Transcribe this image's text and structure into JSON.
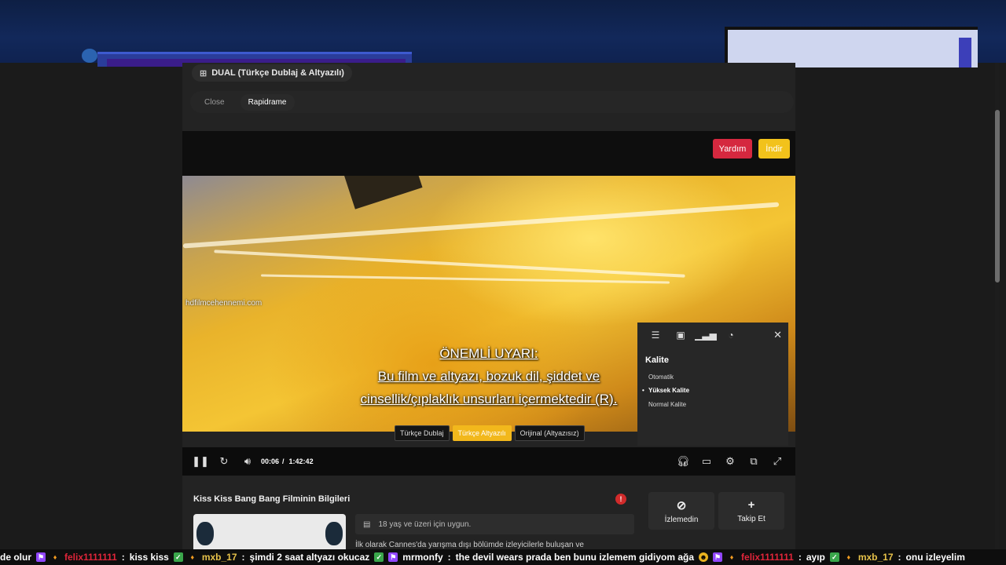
{
  "player": {
    "language_pill": "DUAL (Türkçe Dublaj & Altyazılı)",
    "tabs": [
      {
        "label": "Close"
      },
      {
        "label": "Rapidrame",
        "active": true
      }
    ],
    "help_label": "Yardım",
    "download_label": "İndir",
    "watermark": "hdfilmcehennemi.com",
    "subtitle_lines": [
      "ÖNEMLİ UYARI:",
      "Bu film ve altyazı, bozuk dil, şiddet ve",
      "cinsellik/çıplaklık unsurları içermektedir (R)."
    ],
    "audio_options": [
      {
        "label": "Türkçe Dublaj",
        "selected": false
      },
      {
        "label": "Türkçe Altyazılı",
        "selected": true
      },
      {
        "label": "Orijinal (Altyazısız)",
        "selected": false
      }
    ],
    "time_current": "00:06",
    "time_separator": "/",
    "time_total": "1:42:42",
    "settings": {
      "heading": "Kalite",
      "options": [
        {
          "label": "Otomatik",
          "selected": false
        },
        {
          "label": "Yüksek Kalite",
          "selected": true
        },
        {
          "label": "Normal Kalite",
          "selected": false
        }
      ]
    }
  },
  "info": {
    "title": "Kiss Kiss Bang Bang Filminin Bilgileri",
    "badge": "!",
    "age_rating": "18 yaş ve üzeri için uygun.",
    "description": "İlk olarak Cannes'da yarışma dışı bölümde izleyicilerle buluşan ve",
    "actions": [
      {
        "label": "İzlemedin",
        "icon": "eye-off-icon"
      },
      {
        "label": "Takip Et",
        "icon": "plus-icon"
      }
    ]
  },
  "chat": {
    "messages": [
      {
        "user": "",
        "text": "de olur"
      },
      {
        "user": "felix1111111",
        "text": "kiss kiss"
      },
      {
        "user": "mxb_17",
        "text": "şimdi 2 saat altyazı okucaz"
      },
      {
        "user": "mrmonfy",
        "text": "the devil wears prada  ben bunu izlemem gidiyom ağa"
      },
      {
        "user": "felix1111111",
        "text": "ayıp"
      },
      {
        "user": "mxb_17",
        "text": "onu izleyelim"
      }
    ]
  },
  "colors": {
    "help_button": "#d5283f",
    "download_button": "#f2c21b",
    "selected_audio": "#f2b81c",
    "chat_user_red": "#e0253a",
    "chat_user_gold": "#e7c24a"
  }
}
